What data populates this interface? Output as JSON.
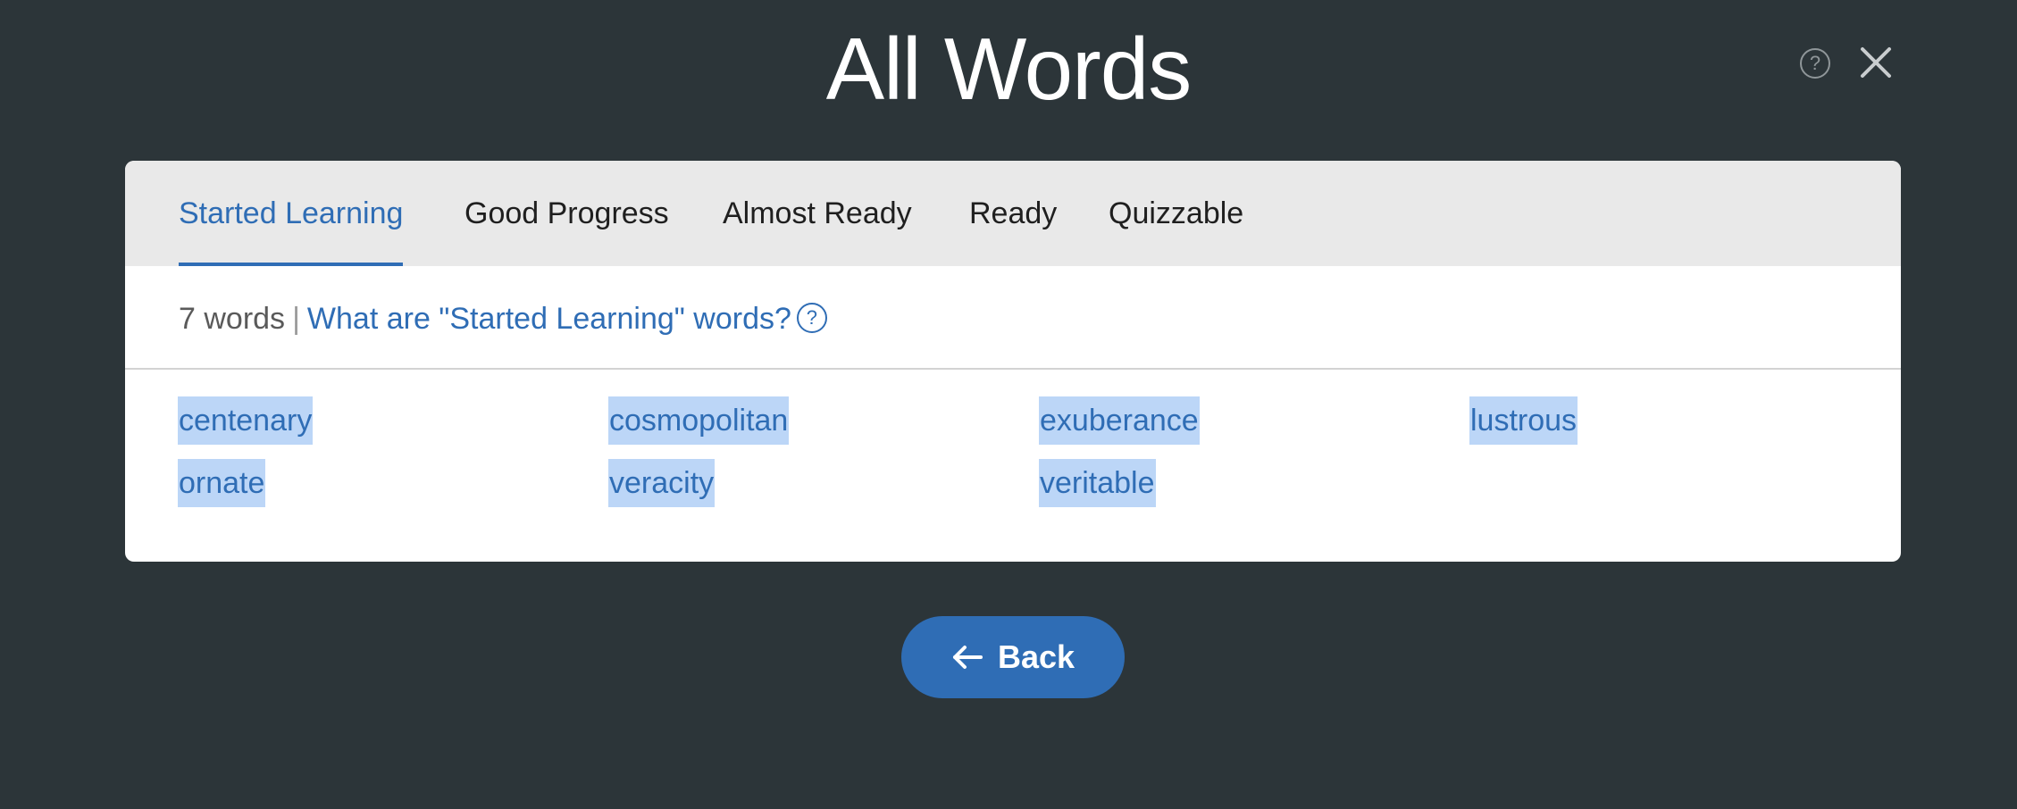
{
  "header": {
    "title": "All Words",
    "help_glyph": "?",
    "icons": [
      "help-icon",
      "close-icon"
    ]
  },
  "tabs": [
    {
      "label": "Started Learning",
      "active": true
    },
    {
      "label": "Good Progress",
      "active": false
    },
    {
      "label": "Almost Ready",
      "active": false
    },
    {
      "label": "Ready",
      "active": false
    },
    {
      "label": "Quizzable",
      "active": false
    }
  ],
  "info": {
    "count": "7 words",
    "separator": "|",
    "link": "What are \"Started Learning\" words?",
    "help_glyph": "?"
  },
  "words": [
    "centenary",
    "cosmopolitan",
    "exuberance",
    "lustrous",
    "ornate",
    "veracity",
    "veritable"
  ],
  "back_button": {
    "label": "Back",
    "icon": "arrow-left-icon"
  },
  "colors": {
    "background": "#2c3539",
    "accent": "#2f6db5",
    "word_highlight": "#bcd6f7",
    "tabbar_bg": "#e9e9e9"
  }
}
